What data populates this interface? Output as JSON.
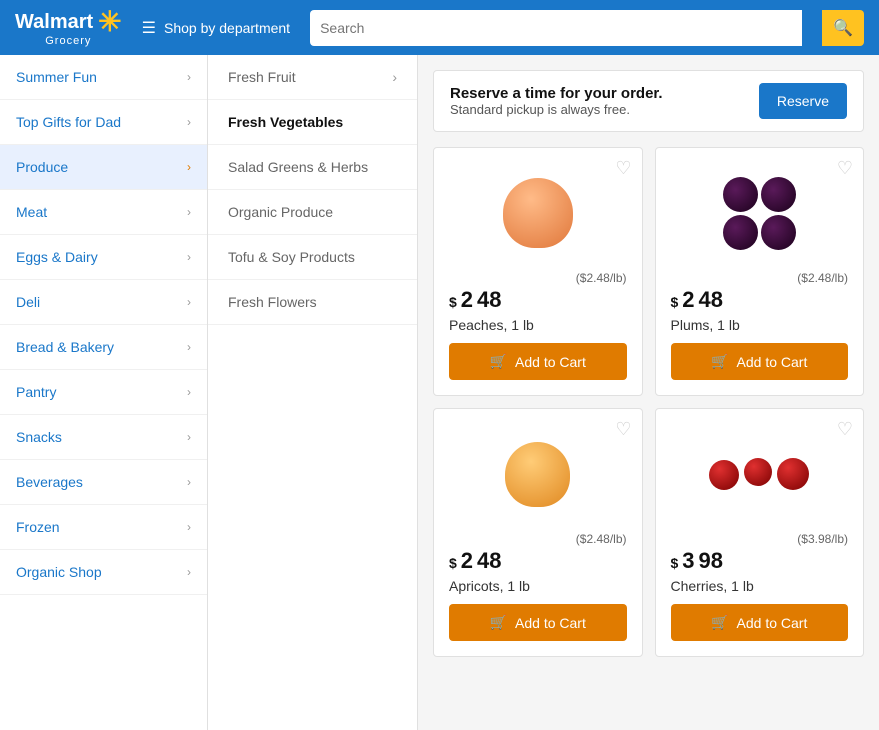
{
  "header": {
    "logo_name": "Walmart",
    "logo_sub": "Grocery",
    "shop_dept": "Shop by department",
    "search_placeholder": "Search",
    "search_icon": "🔍"
  },
  "sidebar": {
    "items": [
      {
        "label": "Summer Fun",
        "active": false
      },
      {
        "label": "Top Gifts for Dad",
        "active": false
      },
      {
        "label": "Produce",
        "active": true
      },
      {
        "label": "Meat",
        "active": false
      },
      {
        "label": "Eggs & Dairy",
        "active": false
      },
      {
        "label": "Deli",
        "active": false
      },
      {
        "label": "Bread & Bakery",
        "active": false
      },
      {
        "label": "Pantry",
        "active": false
      },
      {
        "label": "Snacks",
        "active": false
      },
      {
        "label": "Beverages",
        "active": false
      },
      {
        "label": "Frozen",
        "active": false
      },
      {
        "label": "Organic Shop",
        "active": false
      }
    ]
  },
  "submenu": {
    "items": [
      {
        "label": "Fresh Fruit",
        "selected": false,
        "has_arrow": true
      },
      {
        "label": "Fresh Vegetables",
        "selected": true,
        "has_arrow": false
      },
      {
        "label": "Salad Greens & Herbs",
        "selected": false,
        "has_arrow": false
      },
      {
        "label": "Organic Produce",
        "selected": false,
        "has_arrow": false
      },
      {
        "label": "Tofu & Soy Products",
        "selected": false,
        "has_arrow": false
      },
      {
        "label": "Fresh Flowers",
        "selected": false,
        "has_arrow": false
      }
    ]
  },
  "banner": {
    "title": "Reserve a time for your order.",
    "subtitle": "Standard pickup is always free.",
    "button_label": "Reserve"
  },
  "products": [
    {
      "name": "Peaches, 1 lb",
      "price_dollars": "2",
      "price_cents": "48",
      "price_per_lb": "($2.48/lb)",
      "type": "peach"
    },
    {
      "name": "Plums, 1 lb",
      "price_dollars": "2",
      "price_cents": "48",
      "price_per_lb": "($2.48/lb)",
      "type": "plum"
    },
    {
      "name": "Apricots, 1 lb",
      "price_dollars": "2",
      "price_cents": "48",
      "price_per_lb": "($2.48/lb)",
      "type": "apricot"
    },
    {
      "name": "Cherries, 1 lb",
      "price_dollars": "3",
      "price_cents": "98",
      "price_per_lb": "($3.98/lb)",
      "type": "cherry"
    }
  ],
  "add_to_cart_label": "Add to Cart",
  "colors": {
    "primary_blue": "#1a77c9",
    "orange": "#e07b00",
    "yellow": "#ffc220"
  }
}
